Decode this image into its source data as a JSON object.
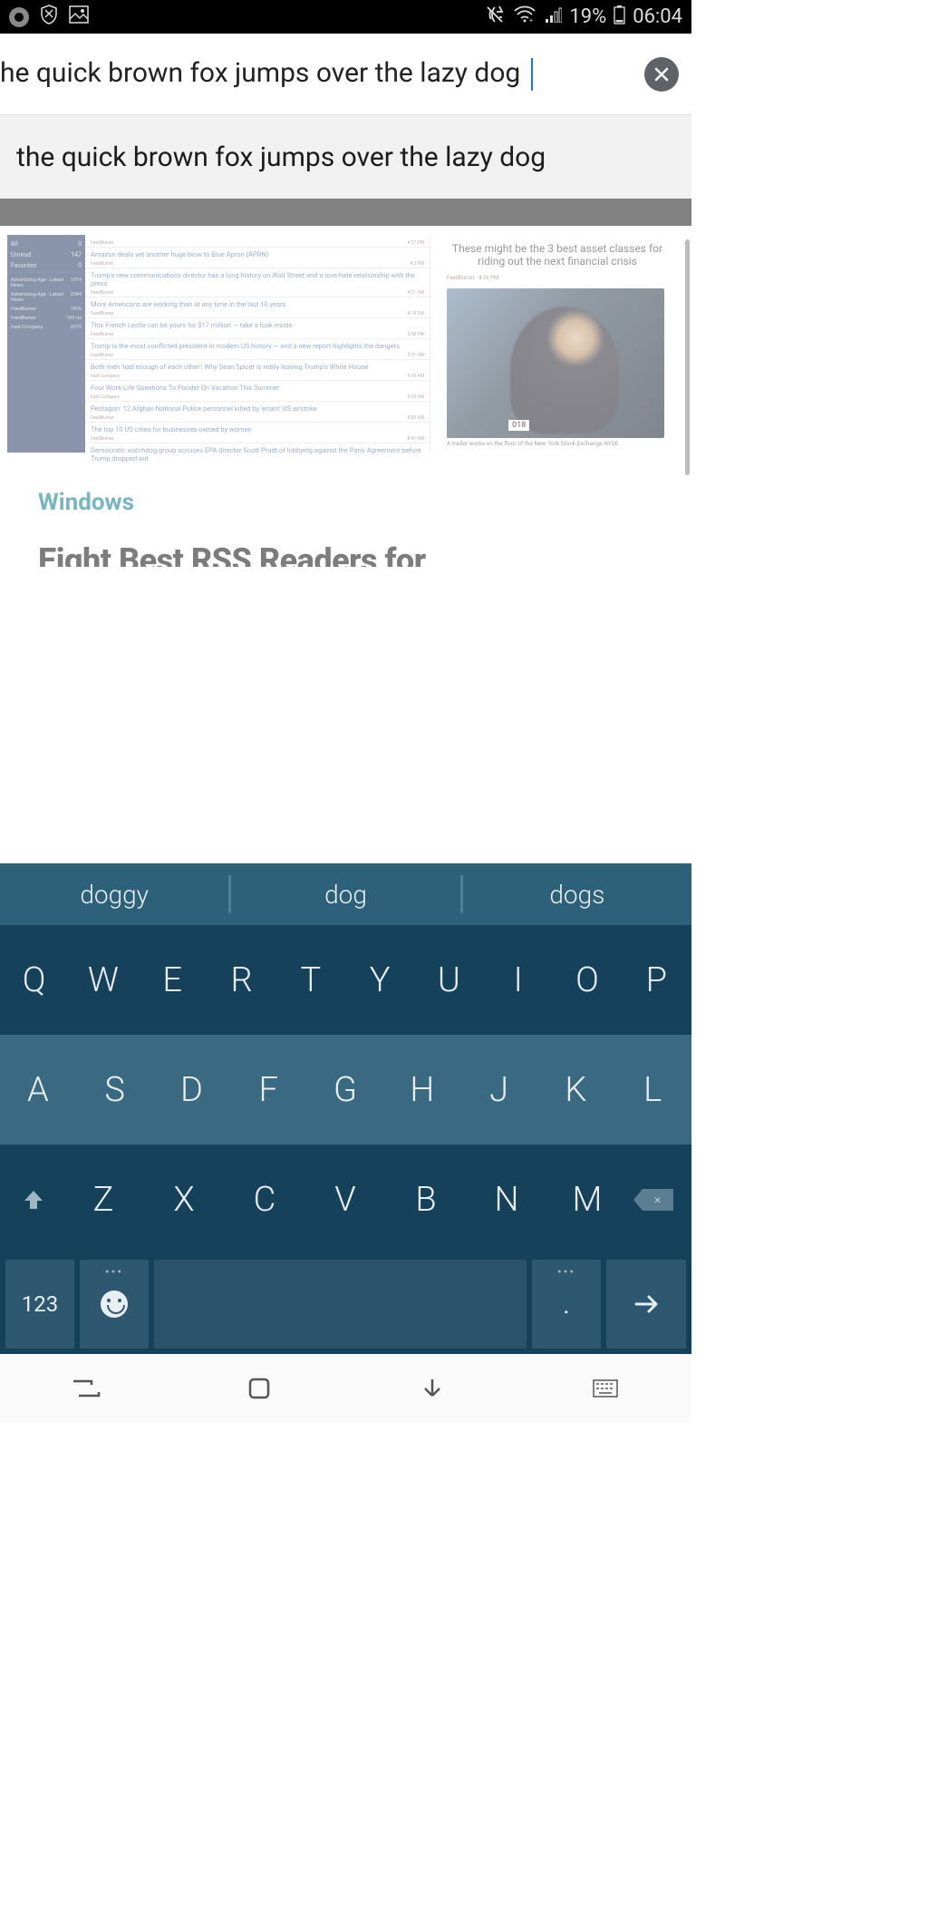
{
  "status": {
    "battery_text": "19%",
    "time": "06:04"
  },
  "url_bar": {
    "text": "he quick brown fox jumps over the lazy dog"
  },
  "suggestion": {
    "text": "the quick brown fox jumps over the lazy dog"
  },
  "page": {
    "right_title": "These might be the 3 best asset classes for riding out the next financial crisis",
    "right_caption": "A trader works on the floor of the New York Stock Exchange NYSE",
    "right_src": "FeedBurner · 4:26 PM",
    "badge": "018",
    "sidebar": {
      "rows": [
        {
          "label": "All",
          "count": "0"
        },
        {
          "label": "Unread",
          "count": "147"
        },
        {
          "label": "Favorites",
          "count": "0"
        }
      ],
      "feeds": [
        {
          "label": "Advertising Age - Latest News",
          "count": "1014"
        },
        {
          "label": "Advertising Age - Latest News",
          "count": "2044"
        },
        {
          "label": "FeedBurner",
          "count": "1876"
        },
        {
          "label": "FeedBurner",
          "count": "100 mi"
        },
        {
          "label": "Fast Company",
          "count": "2019"
        }
      ]
    },
    "feed": [
      {
        "title": "",
        "src": "FeedBurner",
        "time": "4:27 PM"
      },
      {
        "title": "Amazon deals yet another huge blow to Blue Apron (APRN)",
        "src": "FeedBurner",
        "time": "4:2 PM"
      },
      {
        "title": "Trump's new communications director has a long history on Wall Street and a love-hate relationship with the press",
        "src": "FeedBurner",
        "time": "4:21 PM"
      },
      {
        "title": "More Americans are working than at any time in the last 10 years",
        "src": "FeedBurner",
        "time": "4:19 PM"
      },
      {
        "title": "This French castle can be yours for $17 million — take a look inside",
        "src": "FeedBurner",
        "time": "3:58 PM"
      },
      {
        "title": "Trump is the most conflicted president in modern US history — and a new report highlights the dangers",
        "src": "FeedBurner",
        "time": "3:51 PM"
      },
      {
        "title": "Both men 'had enough of each other': Why Sean Spicer is really leaving Trump's White House",
        "src": "Fast Company",
        "time": "9:36 AM"
      },
      {
        "title": "Four Work-Life Questions To Ponder On Vacation This Summer",
        "src": "Fast Company",
        "time": "9:00 AM"
      },
      {
        "title": "Pentagon: 12 Afghan National Police personnel killed by 'errant' US airstrike",
        "src": "FeedBurner",
        "time": "9:06 AM"
      },
      {
        "title": "The top 10 US cities for businesses owned by women",
        "src": "FeedBurner",
        "time": "8:41 AM"
      },
      {
        "title": "Democratic watchdog group accuses EPA director Scott Pruitt of lobbying against the Paris Agreement before Trump dropped out",
        "src": "",
        "time": ""
      }
    ],
    "tag": "Windows",
    "headline": "Eight Best RSS Readers for"
  },
  "keyboard": {
    "suggestions": [
      "doggy",
      "dog",
      "dogs"
    ],
    "row1": [
      "Q",
      "W",
      "E",
      "R",
      "T",
      "Y",
      "U",
      "I",
      "O",
      "P"
    ],
    "row2": [
      "A",
      "S",
      "D",
      "F",
      "G",
      "H",
      "J",
      "K",
      "L"
    ],
    "row3": [
      "Z",
      "X",
      "C",
      "V",
      "B",
      "N",
      "M"
    ],
    "num_key": "123",
    "period": ".",
    "bksp": "×"
  }
}
